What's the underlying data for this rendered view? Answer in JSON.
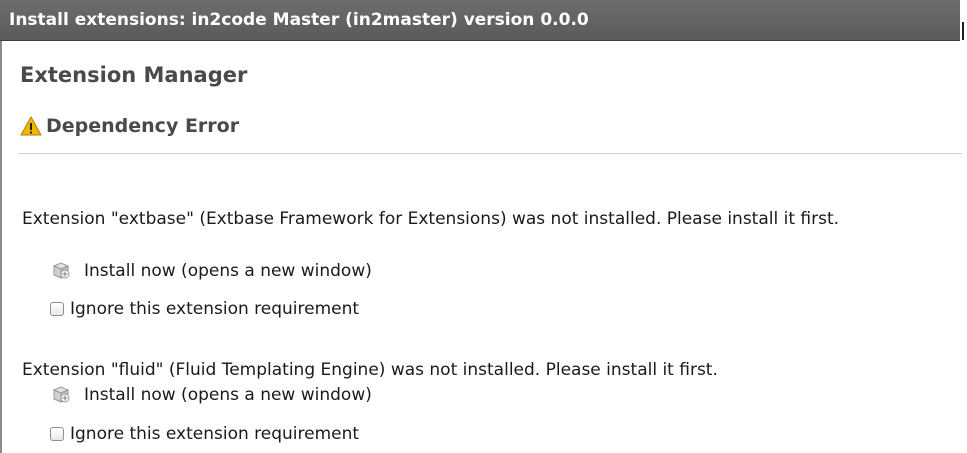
{
  "window": {
    "title": "Install extensions: in2code Master (in2master) version 0.0.0"
  },
  "main": {
    "heading": "Extension Manager",
    "subheading": "Dependency Error",
    "requirements": [
      {
        "message": "Extension \"extbase\" (Extbase Framework for Extensions) was not installed. Please install it first.",
        "install_link": "Install now (opens a new window)",
        "ignore_label": "Ignore this extension requirement",
        "ignore_checked": false
      },
      {
        "message": "Extension \"fluid\" (Fluid Templating Engine) was not installed. Please install it first.",
        "install_link": "Install now (opens a new window)",
        "ignore_label": "Ignore this extension requirement",
        "ignore_checked": false
      }
    ]
  },
  "icons": {
    "warning": "warning-icon",
    "install": "package-icon"
  },
  "colors": {
    "titlebar": "#5f5f5f",
    "warning": "#f2b705"
  }
}
